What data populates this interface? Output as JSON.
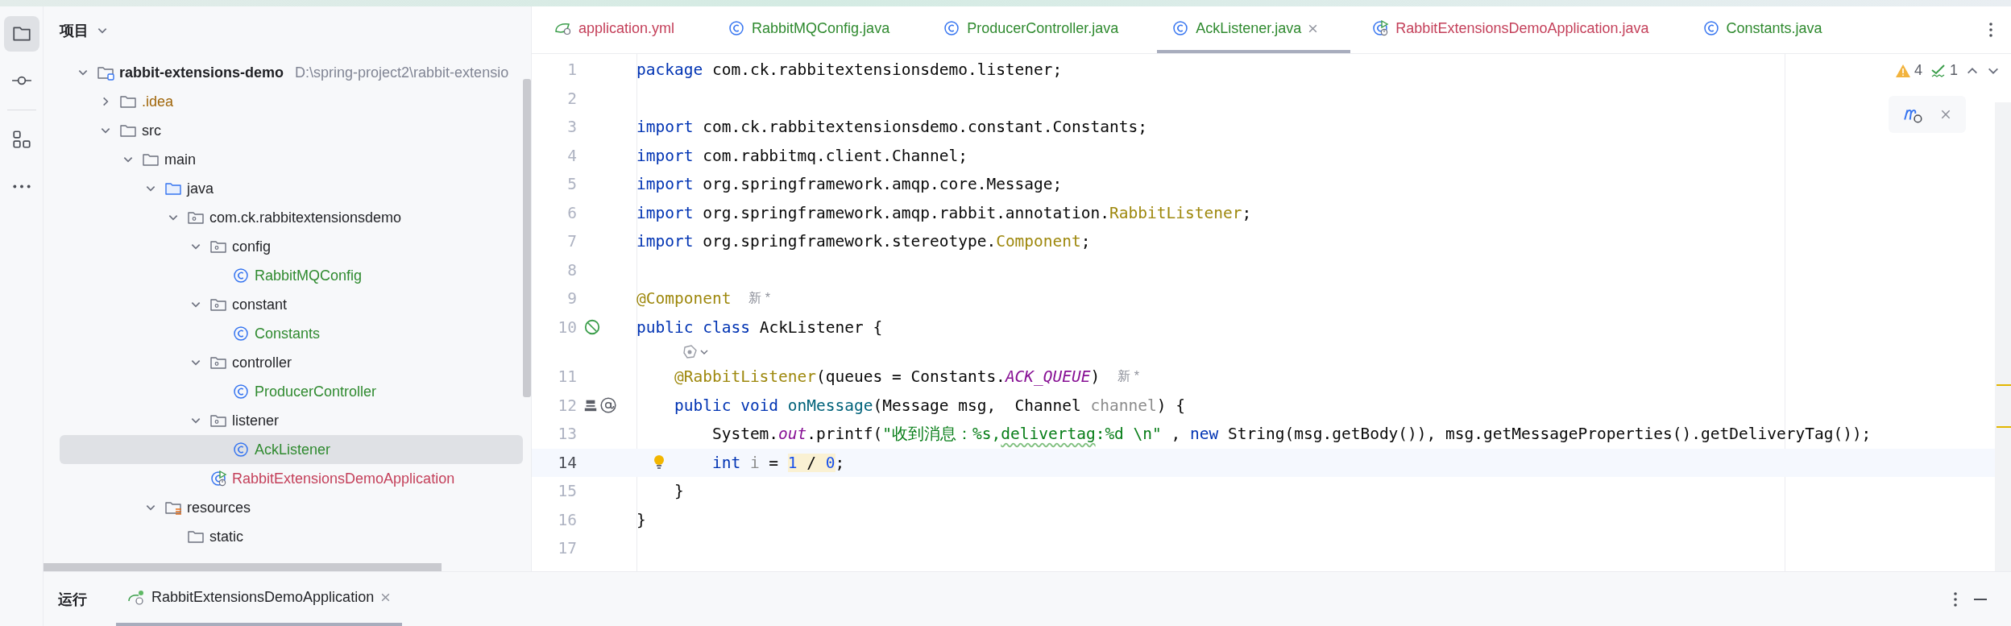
{
  "tool_strip": [
    {
      "kind": "project",
      "selected": true
    },
    {
      "kind": "commit",
      "selected": false
    },
    {
      "kind": "structure",
      "selected": false
    },
    {
      "kind": "more",
      "selected": false
    }
  ],
  "project": {
    "title": "项目",
    "tree": [
      {
        "label": "rabbit-extensions-demo",
        "kind": "module",
        "path": "D:\\spring-project2\\rabbit-extensio",
        "color": "#1f2024",
        "expanded": true,
        "selected": false,
        "children": [
          {
            "label": ".idea",
            "kind": "folder",
            "color": "#a0660a",
            "expanded": false,
            "selected": false
          },
          {
            "label": "src",
            "kind": "folder",
            "color": "#1f2024",
            "expanded": true,
            "selected": false,
            "children": [
              {
                "label": "main",
                "kind": "folder",
                "color": "#1f2024",
                "expanded": true,
                "selected": false,
                "children": [
                  {
                    "label": "java",
                    "kind": "source",
                    "color": "#1f2024",
                    "expanded": true,
                    "selected": false,
                    "children": [
                      {
                        "label": "com.ck.rabbitextensionsdemo",
                        "kind": "package",
                        "color": "#1f2024",
                        "expanded": true,
                        "selected": false,
                        "children": [
                          {
                            "label": "config",
                            "kind": "package",
                            "color": "#1f2024",
                            "expanded": true,
                            "selected": false,
                            "children": [
                              {
                                "label": "RabbitMQConfig",
                                "kind": "class",
                                "color": "#2f8a2f",
                                "selected": false
                              }
                            ]
                          },
                          {
                            "label": "constant",
                            "kind": "package",
                            "color": "#1f2024",
                            "expanded": true,
                            "selected": false,
                            "children": [
                              {
                                "label": "Constants",
                                "kind": "class",
                                "color": "#2f8a2f",
                                "selected": false
                              }
                            ]
                          },
                          {
                            "label": "controller",
                            "kind": "package",
                            "color": "#1f2024",
                            "expanded": true,
                            "selected": false,
                            "children": [
                              {
                                "label": "ProducerController",
                                "kind": "class",
                                "color": "#2f8a2f",
                                "selected": false
                              }
                            ]
                          },
                          {
                            "label": "listener",
                            "kind": "package",
                            "color": "#1f2024",
                            "expanded": true,
                            "selected": false,
                            "children": [
                              {
                                "label": "AckListener",
                                "kind": "class",
                                "color": "#2f8a2f",
                                "selected": true
                              }
                            ]
                          },
                          {
                            "label": "RabbitExtensionsDemoApplication",
                            "kind": "app",
                            "color": "#c4405a",
                            "selected": false
                          }
                        ]
                      }
                    ]
                  },
                  {
                    "label": "resources",
                    "kind": "resources",
                    "color": "#1f2024",
                    "expanded": true,
                    "selected": false,
                    "children": [
                      {
                        "label": "static",
                        "kind": "plain_folder",
                        "color": "#1f2024",
                        "selected": false
                      }
                    ]
                  }
                ]
              }
            ]
          }
        ]
      }
    ]
  },
  "editor": {
    "tabs": [
      {
        "label": "application.yml",
        "kind": "yaml",
        "color": "#c4405a",
        "selected": false
      },
      {
        "label": "RabbitMQConfig.java",
        "kind": "class",
        "color": "#2f8a2f",
        "selected": false
      },
      {
        "label": "ProducerController.java",
        "kind": "class",
        "color": "#2f8a2f",
        "selected": false
      },
      {
        "label": "AckListener.java",
        "kind": "class",
        "color": "#2f8a2f",
        "selected": true
      },
      {
        "label": "RabbitExtensionsDemoApplication.java",
        "kind": "app",
        "color": "#c4405a",
        "selected": false
      },
      {
        "label": "Constants.java",
        "kind": "class",
        "color": "#2f8a2f",
        "selected": false
      }
    ],
    "inspections": [
      {
        "kind": "warning",
        "count": "4"
      },
      {
        "kind": "typo",
        "count": "1"
      }
    ],
    "lines": [
      {
        "kind": "code",
        "number": "1",
        "current": false,
        "tokens": [
          {
            "kind": "keyword",
            "text": "package"
          },
          {
            "kind": "plain",
            "text": " com.ck.rabbitextensionsdemo.listener;"
          }
        ]
      },
      {
        "kind": "code",
        "number": "2",
        "current": false
      },
      {
        "kind": "code",
        "number": "3",
        "current": false,
        "tokens": [
          {
            "kind": "keyword",
            "text": "import"
          },
          {
            "kind": "plain",
            "text": " com.ck.rabbitextensionsdemo.constant.Constants;"
          }
        ]
      },
      {
        "kind": "code",
        "number": "4",
        "current": false,
        "tokens": [
          {
            "kind": "keyword",
            "text": "import"
          },
          {
            "kind": "plain",
            "text": " com.rabbitmq.client.Channel;"
          }
        ]
      },
      {
        "kind": "code",
        "number": "5",
        "current": false,
        "tokens": [
          {
            "kind": "keyword",
            "text": "import"
          },
          {
            "kind": "plain",
            "text": " org.springframework.amqp.core.Message;"
          }
        ]
      },
      {
        "kind": "code",
        "number": "6",
        "current": false,
        "tokens": [
          {
            "kind": "keyword",
            "text": "import"
          },
          {
            "kind": "plain",
            "text": " org.springframework.amqp.rabbit.annotation."
          },
          {
            "kind": "annotation",
            "text": "RabbitListener"
          },
          {
            "kind": "plain",
            "text": ";"
          }
        ]
      },
      {
        "kind": "code",
        "number": "7",
        "current": false,
        "tokens": [
          {
            "kind": "keyword",
            "text": "import"
          },
          {
            "kind": "plain",
            "text": " org.springframework.stereotype."
          },
          {
            "kind": "annotation",
            "text": "Component"
          },
          {
            "kind": "plain",
            "text": ";"
          }
        ]
      },
      {
        "kind": "code",
        "number": "8",
        "current": false
      },
      {
        "kind": "code",
        "number": "9",
        "current": false,
        "hint": "新 *",
        "tokens": [
          {
            "kind": "annotation",
            "text": "@Component"
          }
        ]
      },
      {
        "kind": "code",
        "number": "10",
        "current": false,
        "gutter": [
          {
            "kind": "bean"
          }
        ],
        "tokens": [
          {
            "kind": "keyword",
            "text": "public"
          },
          {
            "kind": "keyword",
            "text": " class"
          },
          {
            "kind": "plain",
            "text": " AckListener {"
          }
        ]
      },
      {
        "kind": "vision"
      },
      {
        "kind": "code",
        "number": "11",
        "current": false,
        "hint": "新 *",
        "tokens": [
          {
            "kind": "annotation",
            "text": "    @RabbitListener"
          },
          {
            "kind": "plain",
            "text": "(queues = Constants."
          },
          {
            "kind": "static",
            "text": "ACK_QUEUE"
          },
          {
            "kind": "plain",
            "text": ")"
          }
        ]
      },
      {
        "kind": "code",
        "number": "12",
        "current": false,
        "gutter": [
          {
            "kind": "queue"
          },
          {
            "kind": "endpoint"
          }
        ],
        "tokens": [
          {
            "kind": "keyword",
            "text": "    public"
          },
          {
            "kind": "keyword",
            "text": " void"
          },
          {
            "kind": "method",
            "text": " onMessage"
          },
          {
            "kind": "plain",
            "text": "(Message msg,  Channel "
          },
          {
            "kind": "unused",
            "text": "channel"
          },
          {
            "kind": "plain",
            "text": ") {"
          }
        ]
      },
      {
        "kind": "code",
        "number": "13",
        "current": false,
        "tokens": [
          {
            "kind": "plain",
            "text": "        System."
          },
          {
            "kind": "static",
            "text": "out"
          },
          {
            "kind": "plain",
            "text": ".printf("
          },
          {
            "kind": "string",
            "text": "\"收到消息：%s,"
          },
          {
            "kind": "string_typo",
            "text": "delivertag"
          },
          {
            "kind": "string",
            "text": ":%d \\n\""
          },
          {
            "kind": "plain",
            "text": " , "
          },
          {
            "kind": "keyword",
            "text": "new"
          },
          {
            "kind": "plain",
            "text": " String(msg.getBody()), msg.getMessageProperties().getDeliveryTag());"
          }
        ]
      },
      {
        "kind": "code",
        "number": "14",
        "current": true,
        "bulb": true,
        "tokens": [
          {
            "kind": "keyword",
            "text": "        int"
          },
          {
            "kind": "unused",
            "text": " i"
          },
          {
            "kind": "plain",
            "text": " = "
          },
          {
            "kind": "number_warning",
            "text": "1"
          },
          {
            "kind": "plain_warning",
            "text": " / "
          },
          {
            "kind": "number_warning",
            "text": "0"
          },
          {
            "kind": "plain",
            "text": ";"
          }
        ]
      },
      {
        "kind": "code",
        "number": "15",
        "current": false,
        "tokens": [
          {
            "kind": "plain",
            "text": "    }"
          }
        ]
      },
      {
        "kind": "code",
        "number": "16",
        "current": false,
        "tokens": [
          {
            "kind": "plain",
            "text": "}"
          }
        ]
      },
      {
        "kind": "code",
        "number": "17",
        "current": false
      }
    ]
  },
  "run_panel": {
    "title": "运行",
    "tabs": [
      {
        "label": "RabbitExtensionsDemoApplication",
        "selected": true
      }
    ]
  }
}
